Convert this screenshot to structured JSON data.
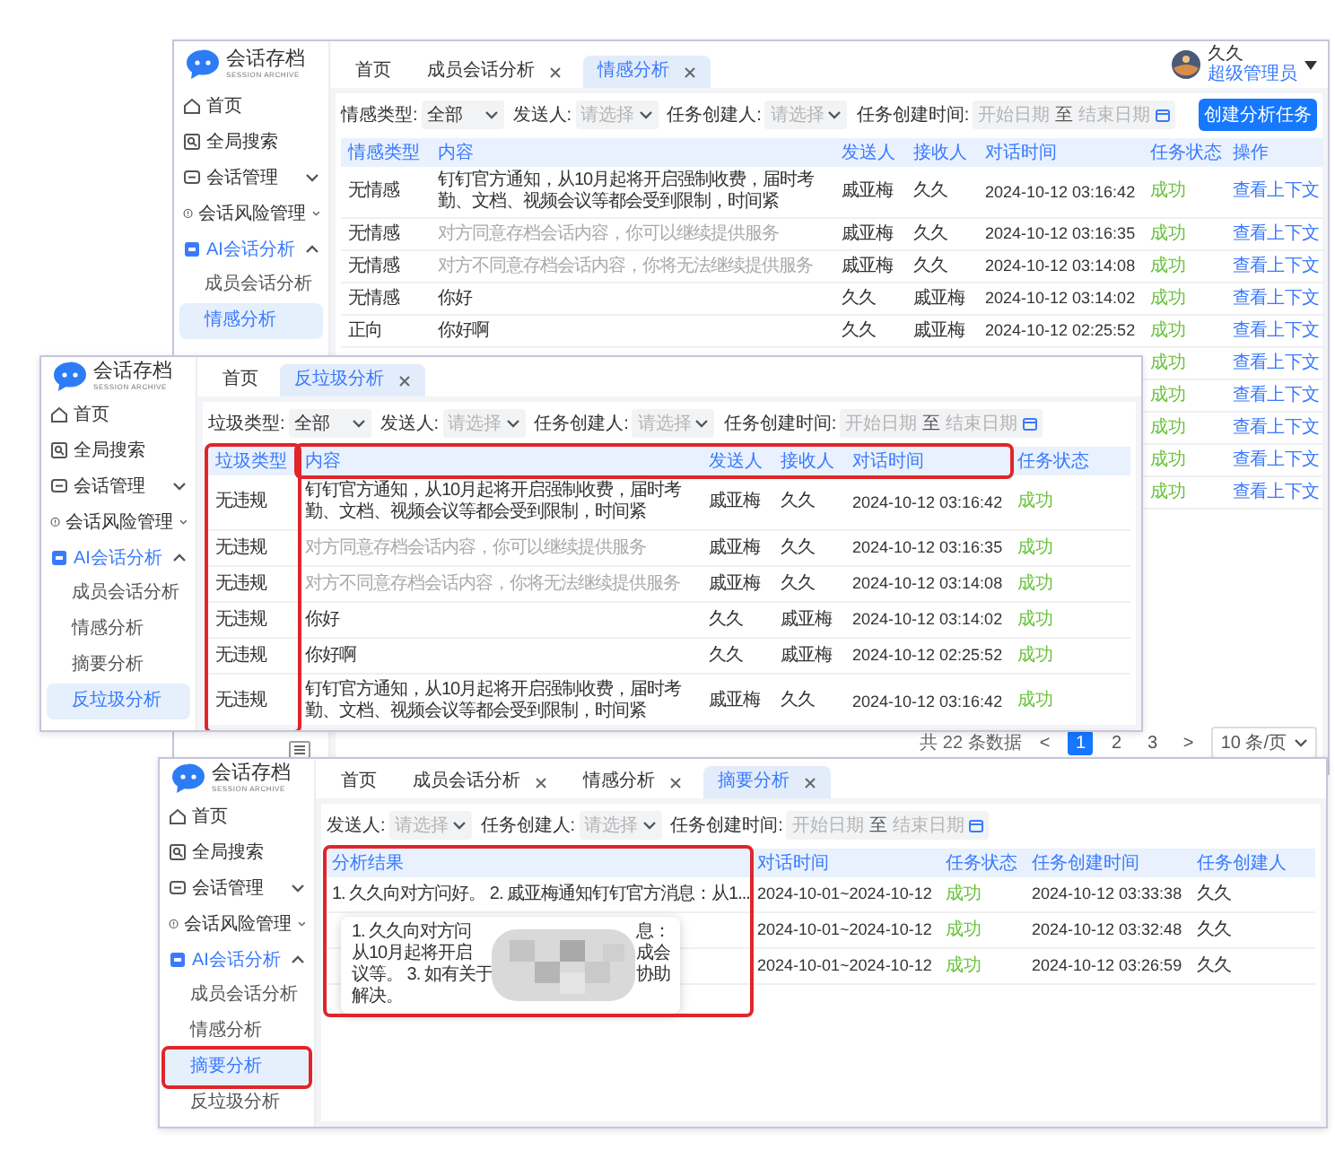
{
  "windows": [
    {
      "sidebar": {
        "logo": {
          "title": "会话存档",
          "subtitle": "SESSION ARCHIVE"
        },
        "collapse_toggle": true,
        "items": [
          {
            "kind": "home",
            "label": "首页"
          },
          {
            "kind": "search",
            "label": "全局搜索"
          },
          {
            "kind": "chat",
            "label": "会话管理",
            "expanded": false
          },
          {
            "kind": "alert",
            "label": "会话风险管理",
            "expanded": false
          },
          {
            "kind": "ai",
            "label": "AI会话分析",
            "expanded": true,
            "children": [
              {
                "label": "成员会话分析",
                "selected": false
              },
              {
                "label": "情感分析",
                "selected": true
              }
            ]
          }
        ]
      },
      "tabs": [
        {
          "label": "首页",
          "closable": false,
          "selected": false
        },
        {
          "label": "成员会话分析",
          "closable": true,
          "selected": false
        },
        {
          "label": "情感分析",
          "closable": true,
          "selected": true
        }
      ],
      "user": {
        "name": "久久",
        "role": "超级管理员"
      },
      "filters": [
        {
          "kind": "select",
          "label": "情感类型:",
          "value": "全部"
        },
        {
          "kind": "select",
          "label": "发送人:",
          "placeholder": "请选择"
        },
        {
          "kind": "select",
          "label": "任务创建人:",
          "placeholder": "请选择"
        },
        {
          "kind": "daterange",
          "label": "任务创建时间:",
          "start_placeholder": "开始日期",
          "separator": "至",
          "end_placeholder": "结束日期"
        }
      ],
      "action_button": "创建分析任务",
      "table": {
        "columns": [
          {
            "label": "情感类型"
          },
          {
            "label": "内容"
          },
          {
            "label": "发送人"
          },
          {
            "label": "接收人"
          },
          {
            "label": "对话时间"
          },
          {
            "label": "任务状态"
          },
          {
            "label": "操作"
          }
        ],
        "rows": [
          {
            "cells": [
              {
                "kind": "text",
                "text": "无情感"
              },
              {
                "kind": "text",
                "text": "钉钉官方通知，从10月起将开启强制收费，届时考勤、文档、视频会议等都会受到限制，时间紧"
              },
              {
                "kind": "text",
                "text": "戚亚梅"
              },
              {
                "kind": "text",
                "text": "久久"
              },
              {
                "kind": "date",
                "text": "2024-10-12 03:16:42"
              },
              {
                "kind": "status",
                "text": "成功"
              },
              {
                "kind": "link",
                "text": "查看上下文"
              }
            ]
          },
          {
            "cells": [
              {
                "kind": "text",
                "text": "无情感"
              },
              {
                "kind": "muted",
                "text": "对方同意存档会话内容，你可以继续提供服务"
              },
              {
                "kind": "text",
                "text": "戚亚梅"
              },
              {
                "kind": "text",
                "text": "久久"
              },
              {
                "kind": "date",
                "text": "2024-10-12 03:16:35"
              },
              {
                "kind": "status",
                "text": "成功"
              },
              {
                "kind": "link",
                "text": "查看上下文"
              }
            ]
          },
          {
            "cells": [
              {
                "kind": "text",
                "text": "无情感"
              },
              {
                "kind": "muted",
                "text": "对方不同意存档会话内容，你将无法继续提供服务"
              },
              {
                "kind": "text",
                "text": "戚亚梅"
              },
              {
                "kind": "text",
                "text": "久久"
              },
              {
                "kind": "date",
                "text": "2024-10-12 03:14:08"
              },
              {
                "kind": "status",
                "text": "成功"
              },
              {
                "kind": "link",
                "text": "查看上下文"
              }
            ]
          },
          {
            "cells": [
              {
                "kind": "text",
                "text": "无情感"
              },
              {
                "kind": "text",
                "text": "你好"
              },
              {
                "kind": "text",
                "text": "久久"
              },
              {
                "kind": "text",
                "text": "戚亚梅"
              },
              {
                "kind": "date",
                "text": "2024-10-12 03:14:02"
              },
              {
                "kind": "status",
                "text": "成功"
              },
              {
                "kind": "link",
                "text": "查看上下文"
              }
            ]
          },
          {
            "cells": [
              {
                "kind": "text",
                "text": "正向"
              },
              {
                "kind": "text",
                "text": "你好啊"
              },
              {
                "kind": "text",
                "text": "久久"
              },
              {
                "kind": "text",
                "text": "戚亚梅"
              },
              {
                "kind": "date",
                "text": "2024-10-12 02:25:52"
              },
              {
                "kind": "status",
                "text": "成功"
              },
              {
                "kind": "link",
                "text": "查看上下文"
              }
            ]
          },
          {
            "cells": [
              null,
              null,
              null,
              null,
              null,
              {
                "kind": "status",
                "text": "成功"
              },
              {
                "kind": "link",
                "text": "查看上下文"
              }
            ]
          },
          {
            "cells": [
              null,
              null,
              null,
              null,
              null,
              {
                "kind": "status",
                "text": "成功"
              },
              {
                "kind": "link",
                "text": "查看上下文"
              }
            ]
          },
          {
            "cells": [
              null,
              null,
              null,
              null,
              null,
              {
                "kind": "status",
                "text": "成功"
              },
              {
                "kind": "link",
                "text": "查看上下文"
              }
            ]
          },
          {
            "cells": [
              null,
              null,
              null,
              null,
              null,
              {
                "kind": "status",
                "text": "成功"
              },
              {
                "kind": "link",
                "text": "查看上下文"
              }
            ]
          },
          {
            "cells": [
              null,
              null,
              null,
              null,
              null,
              {
                "kind": "status",
                "text": "成功"
              },
              {
                "kind": "link",
                "text": "查看上下文"
              }
            ]
          }
        ]
      },
      "pagination": {
        "total": "共 22 条数据",
        "prev": "<",
        "pages": [
          {
            "label": "1",
            "selected": true
          },
          {
            "label": "2",
            "selected": false
          },
          {
            "label": "3",
            "selected": false
          }
        ],
        "next": ">",
        "page_size": "10 条/页"
      }
    },
    {
      "sidebar": {
        "logo": {
          "title": "会话存档",
          "subtitle": "SESSION ARCHIVE"
        },
        "items": [
          {
            "kind": "home",
            "label": "首页"
          },
          {
            "kind": "search",
            "label": "全局搜索"
          },
          {
            "kind": "chat",
            "label": "会话管理",
            "expanded": false
          },
          {
            "kind": "alert",
            "label": "会话风险管理",
            "expanded": false
          },
          {
            "kind": "ai",
            "label": "AI会话分析",
            "expanded": true,
            "children": [
              {
                "label": "成员会话分析",
                "selected": false
              },
              {
                "label": "情感分析",
                "selected": false
              },
              {
                "label": "摘要分析",
                "selected": false
              },
              {
                "label": "反垃圾分析",
                "selected": true
              }
            ]
          }
        ]
      },
      "tabs": [
        {
          "label": "首页",
          "closable": false,
          "selected": false
        },
        {
          "label": "反垃圾分析",
          "closable": true,
          "selected": true
        }
      ],
      "filters": [
        {
          "kind": "select",
          "label": "垃圾类型:",
          "value": "全部"
        },
        {
          "kind": "select",
          "label": "发送人:",
          "placeholder": "请选择"
        },
        {
          "kind": "select",
          "label": "任务创建人:",
          "placeholder": "请选择"
        },
        {
          "kind": "daterange",
          "label": "任务创建时间:",
          "start_placeholder": "开始日期",
          "separator": "至",
          "end_placeholder": "结束日期"
        }
      ],
      "table": {
        "columns": [
          {
            "label": "垃圾类型",
            "outline_column": true,
            "outline_header": false
          },
          {
            "label": "内容",
            "outline_column": false,
            "outline_header": true
          },
          {
            "label": "发送人",
            "outline_column": false,
            "outline_header": true
          },
          {
            "label": "接收人",
            "outline_column": false,
            "outline_header": true
          },
          {
            "label": "对话时间",
            "outline_column": false,
            "outline_header": true
          },
          {
            "label": "任务状态",
            "outline_column": false,
            "outline_header": false
          }
        ],
        "rows": [
          {
            "cells": [
              {
                "kind": "text",
                "text": "无违规"
              },
              {
                "kind": "text",
                "text": "钉钉官方通知，从10月起将开启强制收费，届时考勤、文档、视频会议等都会受到限制，时间紧"
              },
              {
                "kind": "text",
                "text": "戚亚梅"
              },
              {
                "kind": "text",
                "text": "久久"
              },
              {
                "kind": "date",
                "text": "2024-10-12 03:16:42"
              },
              {
                "kind": "status",
                "text": "成功"
              }
            ]
          },
          {
            "cells": [
              {
                "kind": "text",
                "text": "无违规"
              },
              {
                "kind": "muted",
                "text": "对方同意存档会话内容，你可以继续提供服务"
              },
              {
                "kind": "text",
                "text": "戚亚梅"
              },
              {
                "kind": "text",
                "text": "久久"
              },
              {
                "kind": "date",
                "text": "2024-10-12 03:16:35"
              },
              {
                "kind": "status",
                "text": "成功"
              }
            ]
          },
          {
            "cells": [
              {
                "kind": "text",
                "text": "无违规"
              },
              {
                "kind": "muted",
                "text": "对方不同意存档会话内容，你将无法继续提供服务"
              },
              {
                "kind": "text",
                "text": "戚亚梅"
              },
              {
                "kind": "text",
                "text": "久久"
              },
              {
                "kind": "date",
                "text": "2024-10-12 03:14:08"
              },
              {
                "kind": "status",
                "text": "成功"
              }
            ]
          },
          {
            "cells": [
              {
                "kind": "text",
                "text": "无违规"
              },
              {
                "kind": "text",
                "text": "你好"
              },
              {
                "kind": "text",
                "text": "久久"
              },
              {
                "kind": "text",
                "text": "戚亚梅"
              },
              {
                "kind": "date",
                "text": "2024-10-12 03:14:02"
              },
              {
                "kind": "status",
                "text": "成功"
              }
            ]
          },
          {
            "cells": [
              {
                "kind": "text",
                "text": "无违规"
              },
              {
                "kind": "text",
                "text": "你好啊"
              },
              {
                "kind": "text",
                "text": "久久"
              },
              {
                "kind": "text",
                "text": "戚亚梅"
              },
              {
                "kind": "date",
                "text": "2024-10-12 02:25:52"
              },
              {
                "kind": "status",
                "text": "成功"
              }
            ]
          },
          {
            "cells": [
              {
                "kind": "text",
                "text": "无违规"
              },
              {
                "kind": "text",
                "text": "钉钉官方通知，从10月起将开启强制收费，届时考勤、文档、视频会议等都会受到限制，时间紧"
              },
              {
                "kind": "text",
                "text": "戚亚梅"
              },
              {
                "kind": "text",
                "text": "久久"
              },
              {
                "kind": "date",
                "text": "2024-10-12 03:16:42"
              },
              {
                "kind": "status",
                "text": "成功"
              }
            ]
          }
        ]
      }
    },
    {
      "sidebar": {
        "logo": {
          "title": "会话存档",
          "subtitle": "SESSION ARCHIVE"
        },
        "items": [
          {
            "kind": "home",
            "label": "首页"
          },
          {
            "kind": "search",
            "label": "全局搜索"
          },
          {
            "kind": "chat",
            "label": "会话管理",
            "expanded": false
          },
          {
            "kind": "alert",
            "label": "会话风险管理",
            "expanded": false
          },
          {
            "kind": "ai",
            "label": "AI会话分析",
            "expanded": true,
            "children": [
              {
                "label": "成员会话分析",
                "selected": false,
                "outlined": false
              },
              {
                "label": "情感分析",
                "selected": false,
                "outlined": false
              },
              {
                "label": "摘要分析",
                "selected": true,
                "outlined": true
              },
              {
                "label": "反垃圾分析",
                "selected": false,
                "outlined": false
              }
            ]
          }
        ]
      },
      "tabs": [
        {
          "label": "首页",
          "closable": false,
          "selected": false
        },
        {
          "label": "成员会话分析",
          "closable": true,
          "selected": false
        },
        {
          "label": "情感分析",
          "closable": true,
          "selected": false
        },
        {
          "label": "摘要分析",
          "closable": true,
          "selected": true
        }
      ],
      "filters": [
        {
          "kind": "select",
          "label": "发送人:",
          "placeholder": "请选择"
        },
        {
          "kind": "select",
          "label": "任务创建人:",
          "placeholder": "请选择"
        },
        {
          "kind": "daterange",
          "label": "任务创建时间:",
          "start_placeholder": "开始日期",
          "separator": "至",
          "end_placeholder": "结束日期"
        }
      ],
      "table": {
        "columns": [
          {
            "label": "分析结果",
            "outline_column": true
          },
          {
            "label": "对话时间",
            "outline_column": false
          },
          {
            "label": "任务状态",
            "outline_column": false
          },
          {
            "label": "任务创建时间",
            "outline_column": false
          },
          {
            "label": "任务创建人",
            "outline_column": false
          }
        ],
        "rows": [
          {
            "cells": [
              {
                "kind": "text",
                "text": "1. 久久向对方问好。 2. 戚亚梅通知钉钉官方消息：从1..."
              },
              {
                "kind": "date",
                "text": "2024-10-01~2024-10-12"
              },
              {
                "kind": "status",
                "text": "成功"
              },
              {
                "kind": "date",
                "text": "2024-10-12 03:33:38"
              },
              {
                "kind": "text",
                "text": "久久"
              }
            ]
          },
          {
            "cells": [
              null,
              {
                "kind": "date",
                "text": "2024-10-01~2024-10-12"
              },
              {
                "kind": "status",
                "text": "成功"
              },
              {
                "kind": "date",
                "text": "2024-10-12 03:32:48"
              },
              {
                "kind": "text",
                "text": "久久"
              }
            ]
          },
          {
            "cells": [
              null,
              {
                "kind": "date",
                "text": "2024-10-01~2024-10-12"
              },
              {
                "kind": "status",
                "text": "成功"
              },
              {
                "kind": "date",
                "text": "2024-10-12 03:26:59"
              },
              {
                "kind": "text",
                "text": "久久"
              }
            ]
          }
        ]
      },
      "tooltip": {
        "lines": [
          {
            "left": "1. 久久向对方问",
            "right": "息："
          },
          {
            "left": "从10月起将开启",
            "right": "成会"
          },
          {
            "left": "议等。 3. 如有关于",
            "right": "协助"
          },
          {
            "left": "解决。"
          }
        ]
      }
    }
  ]
}
